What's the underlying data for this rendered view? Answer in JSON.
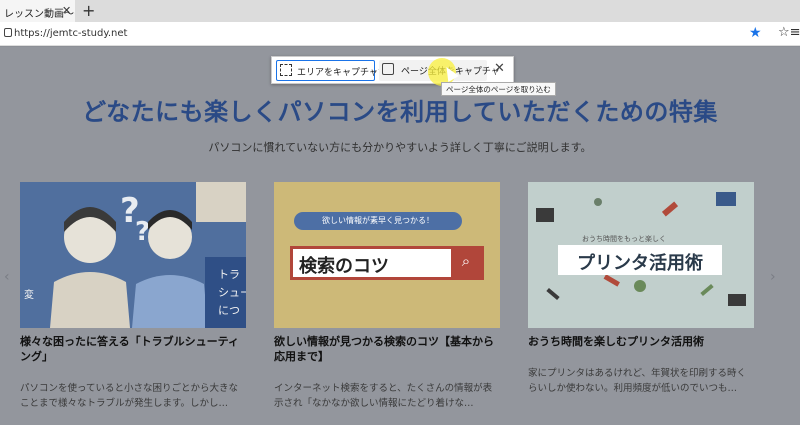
{
  "browser": {
    "tab_title": "レッスン動画～もっ",
    "tab_close": "✕",
    "new_tab": "+",
    "url": "https://jemtc-study.net",
    "favorite_star": "★",
    "favorites_icon": "☆≡"
  },
  "capture_toolbar": {
    "area_label": "エリアをキャプチャする",
    "page_label": "ページ全体をキャプチャ",
    "close": "✕",
    "tooltip": "ページ全体のページを取り込む"
  },
  "page": {
    "headline": "どなたにも楽しくパソコンを利用していただくための特集",
    "subline": "パソコンに慣れていない方にも分かりやすいよう詳しく丁寧にご説明します。",
    "prev_arrow": "‹",
    "next_arrow": "›",
    "cards": [
      {
        "title": "様々な困ったに答える「トラブルシューティング」",
        "desc": "パソコンを使っていると小さな困りごとから大きなことまで様々なトラブルが発生します。しかし…",
        "image_icon": "trouble-illustration",
        "image_text": "トラ\nシュー\nにつ",
        "image_text2": "変"
      },
      {
        "title": "欲しい情報が見つかる検索のコツ【基本から応用まで】",
        "desc": "インターネット検索をすると、たくさんの情報が表示され「なかなか欲しい情報にたどり着けな…",
        "image_icon": "search-illustration",
        "image_banner": "欲しい情報が素早く見つかる！",
        "image_text": "検索のコツ"
      },
      {
        "title": "おうち時間を楽しむプリンタ活用術",
        "desc": "家にプリンタはあるけれど、年賀状を印刷する時くらいしか使わない。利用頻度が低いのでいつも…",
        "image_icon": "printer-illustration",
        "image_banner": "おうち時間をもっと楽しく",
        "image_text": "プリンタ活用術"
      }
    ]
  }
}
